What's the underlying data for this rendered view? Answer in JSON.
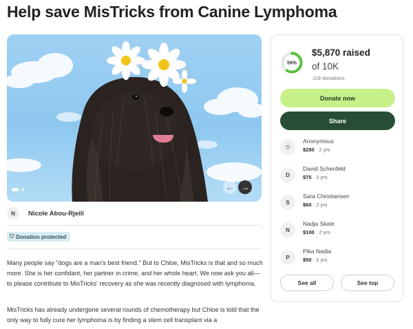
{
  "page": {
    "title": "Help save MisTricks from Canine Lymphoma"
  },
  "carousel": {
    "prev_icon": "←",
    "next_icon": "→"
  },
  "organizer": {
    "initial": "N",
    "name": "Nicole Abou-Rjeili"
  },
  "badge": {
    "icon": "shield-icon",
    "label": "Donation protected"
  },
  "story": {
    "paragraphs": [
      "Many people say \"dogs are a man's best friend.\" But to Chloe, MisTricks is that and so much more. She is her confidant, her partner in crime, and her whole heart. We now ask you all— to please contribute to MisTricks' recovery as she was recently diagnosed with lymphoma.",
      "MisTricks has already undergone several rounds of chemotherapy but Chloe is told that the only way to fully cure her lymphoma is by finding a stem cell transplant via a"
    ]
  },
  "progress": {
    "percent_label": "59%",
    "fraction": 0.587,
    "raised": "$5,870 raised",
    "goal": "of 10K",
    "donations": "118 donations",
    "ring_color": "#5bbf3f",
    "track_color": "#e6e6e6"
  },
  "actions": {
    "donate_label": "Donate now",
    "share_label": "Share",
    "see_all_label": "See all",
    "see_top_label": "See top"
  },
  "donors": [
    {
      "avatar": "♡",
      "avatar_icon": "heart-hand-icon",
      "name": "Anonymous",
      "amount": "$250",
      "time": "2 yrs"
    },
    {
      "avatar": "D",
      "name": "David Schenfeld",
      "amount": "$75",
      "time": "2 yrs"
    },
    {
      "avatar": "S",
      "name": "Sara Christiansen",
      "amount": "$60",
      "time": "2 yrs"
    },
    {
      "avatar": "N",
      "name": "Nadja Skale",
      "amount": "$100",
      "time": "2 yrs"
    },
    {
      "avatar": "P",
      "name": "Pika Nadia",
      "amount": "$50",
      "time": "2 yrs"
    }
  ],
  "colors": {
    "donate_button": "#c7f088",
    "share_button": "#274e34",
    "badge_bg": "#d9ecef"
  }
}
